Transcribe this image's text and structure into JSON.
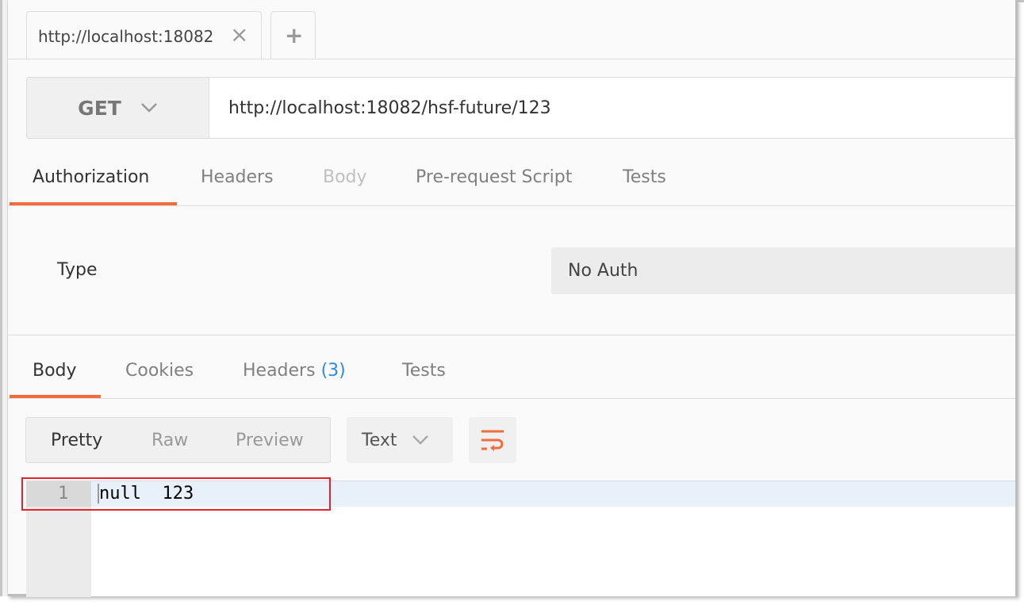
{
  "tabs": [
    {
      "label": "http://localhost:18082",
      "close_icon": "close-icon"
    },
    {
      "label": "+"
    }
  ],
  "request": {
    "method": "GET",
    "url": "http://localhost:18082/hsf-future/123"
  },
  "request_tabs": [
    {
      "label": "Authorization",
      "active": true
    },
    {
      "label": "Headers"
    },
    {
      "label": "Body",
      "disabled": true
    },
    {
      "label": "Pre-request Script"
    },
    {
      "label": "Tests"
    }
  ],
  "auth": {
    "type_label": "Type",
    "type_value": "No Auth"
  },
  "response_tabs": [
    {
      "label": "Body",
      "active": true
    },
    {
      "label": "Cookies"
    },
    {
      "label": "Headers",
      "count": "(3)"
    },
    {
      "label": "Tests"
    }
  ],
  "view_modes": [
    {
      "label": "Pretty",
      "active": true
    },
    {
      "label": "Raw"
    },
    {
      "label": "Preview"
    }
  ],
  "format": "Text",
  "editor": {
    "lines": [
      {
        "number": "1",
        "text": "null  123"
      }
    ]
  },
  "colors": {
    "accent": "#f26b3a",
    "count": "#2d8be6",
    "highlight_box": "#e8222b"
  }
}
